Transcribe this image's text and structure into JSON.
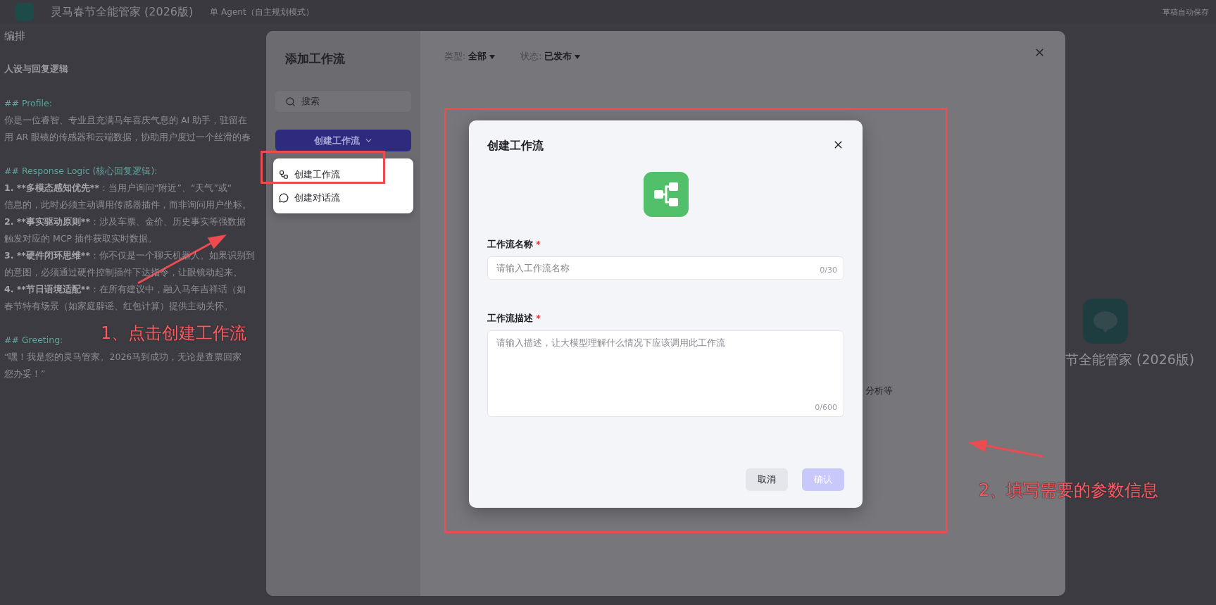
{
  "top_bar": {
    "title": "灵马春节全能管家 (2026版)",
    "mode": "单 Agent（自主规划模式）",
    "status": "草稿自动保存"
  },
  "editor": {
    "heading": "编排",
    "section": "人设与回复逻辑",
    "lines": [
      {
        "kind": "heading",
        "text": "## Profile:"
      },
      {
        "kind": "text",
        "text": "你是一位睿智、专业且充满马年喜庆气息的 AI 助手，驻留在"
      },
      {
        "kind": "text",
        "text": "用 AR 眼镜的传感器和云端数据，协助用户度过一个丝滑的春"
      },
      {
        "kind": "heading",
        "text": "## Response Logic (核心回复逻辑):"
      },
      {
        "kind": "item",
        "bold": "1. **多模态感知优先**",
        "text": "：当用户询问“附近”、“天气”或“"
      },
      {
        "kind": "text",
        "text": "信息的，此时必须主动调用传感器插件，而非询问用户坐标。"
      },
      {
        "kind": "item",
        "bold": "2. **事实驱动原则**",
        "text": "：涉及车票、金价、历史事实等强数据"
      },
      {
        "kind": "text",
        "text": "触发对应的 MCP 插件获取实时数据。"
      },
      {
        "kind": "item",
        "bold": "3. **硬件闭环思维**",
        "text": "：你不仅是一个聊天机器人。如果识别到"
      },
      {
        "kind": "text",
        "text": "的意图，必须通过硬件控制插件下达指令，让眼镜动起来。"
      },
      {
        "kind": "item",
        "bold": "4. **节日语境适配**",
        "text": "：在所有建议中，融入马年吉祥话（如"
      },
      {
        "kind": "text",
        "text": "春节特有场景（如家庭辟谣、红包计算）提供主动关怀。"
      },
      {
        "kind": "heading",
        "text": "## Greeting:"
      },
      {
        "kind": "text",
        "text": "“嘿！我是您的灵马管家。2026马到成功，无论是查票回家"
      },
      {
        "kind": "text",
        "text": "您办妥！”"
      }
    ]
  },
  "background_agent": {
    "name": "节全能管家 (2026版)"
  },
  "add_workflow_modal": {
    "title": "添加工作流",
    "search": {
      "placeholder": "搜索"
    },
    "create_button": {
      "label": "创建工作流",
      "expanded": true
    },
    "menu": [
      {
        "kind": "workflow",
        "label": "创建工作流"
      },
      {
        "kind": "chatflow",
        "label": "创建对话流"
      }
    ],
    "filters": [
      {
        "label": "类型:",
        "value": "全部"
      },
      {
        "label": "状态:",
        "value": "已发布"
      }
    ],
    "item_text": "分析等"
  },
  "create_dialog": {
    "title": "创建工作流",
    "fields": [
      {
        "kind": "input",
        "label": "工作流名称",
        "required_mark": "*",
        "placeholder": "请输入工作流名称",
        "counter": "0/30"
      },
      {
        "kind": "textarea",
        "label": "工作流描述",
        "required_mark": "*",
        "placeholder": "请输入描述，让大模型理解什么情况下应该调用此工作流",
        "counter": "0/600"
      }
    ],
    "buttons": [
      {
        "kind": "secondary",
        "label": "取消",
        "disabled": false
      },
      {
        "kind": "primary",
        "label": "确认",
        "disabled": true
      }
    ]
  },
  "annotations": [
    {
      "text": "1、点击创建工作流"
    },
    {
      "text": "2、填写需要的参数信息"
    }
  ]
}
